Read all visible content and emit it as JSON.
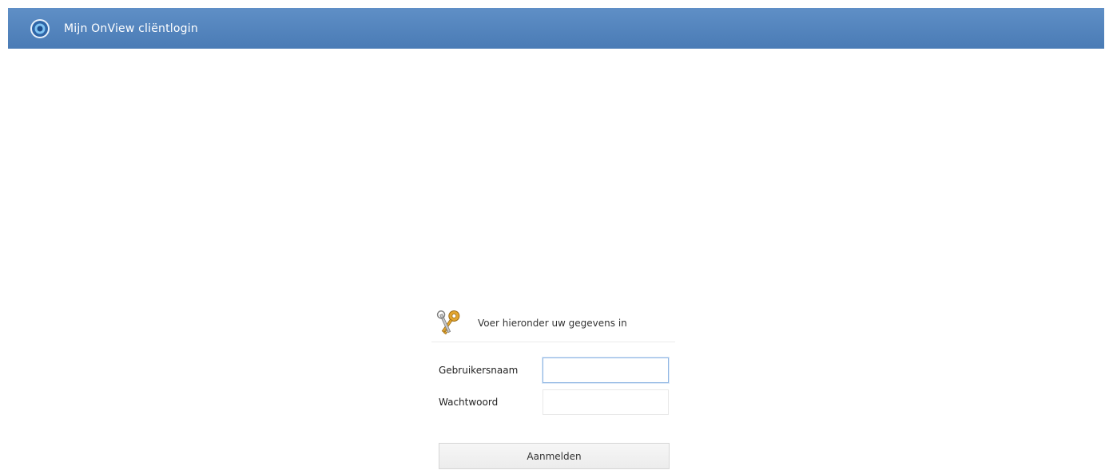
{
  "header": {
    "title": "Mijn OnView cliëntlogin",
    "logo_icon": "onview-logo-icon",
    "background": "#5585bd"
  },
  "login": {
    "icon": "key-icon",
    "instruction": "Voer hieronder uw gegevens in",
    "username": {
      "label": "Gebruikersnaam",
      "value": "",
      "placeholder": ""
    },
    "password": {
      "label": "Wachtwoord",
      "value": "",
      "placeholder": ""
    },
    "submit_label": "Aanmelden"
  }
}
